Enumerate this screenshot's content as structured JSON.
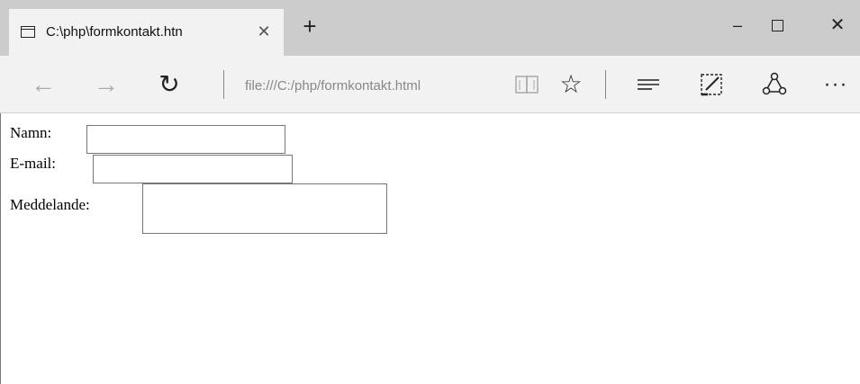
{
  "tab": {
    "title": "C:\\php\\formkontakt.htn",
    "close_glyph": "✕",
    "new_tab_glyph": "+"
  },
  "window_controls": {
    "minimize": "–",
    "close": "✕"
  },
  "toolbar": {
    "back_glyph": "←",
    "forward_glyph": "→",
    "refresh_glyph": "↻",
    "address": "file:///C:/php/formkontakt.html",
    "favorite_glyph": "☆",
    "more_glyph": "···"
  },
  "icons": [
    "tab-page-icon",
    "close-icon",
    "plus-icon",
    "minimize-icon",
    "maximize-icon",
    "window-close-icon",
    "back-arrow-icon",
    "forward-arrow-icon",
    "refresh-icon",
    "reading-view-icon",
    "star-icon",
    "hub-icon",
    "web-note-icon",
    "share-icon",
    "more-icon"
  ],
  "form": {
    "name_label": "Namn:",
    "name_value": "",
    "email_label": "E-mail:",
    "email_value": "",
    "message_label": "Meddelande:",
    "message_value": ""
  }
}
